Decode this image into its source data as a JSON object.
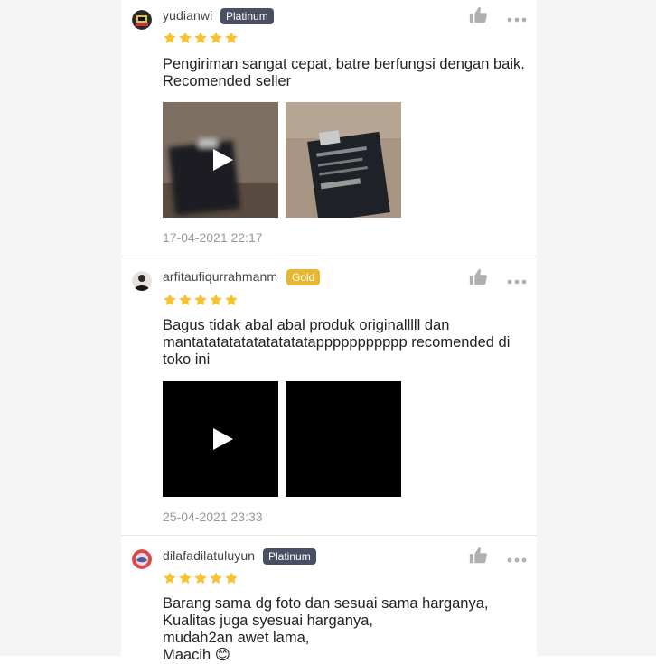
{
  "reviews": [
    {
      "username": "yudianwi",
      "badge": "Platinum",
      "rating": 5,
      "text_lines": [
        "Pengiriman sangat cepat, batre berfungsi dengan baik.",
        "Recomended seller"
      ],
      "timestamp": "17-04-2021 22:17",
      "media": [
        {
          "kind": "video",
          "icon": "play-icon"
        },
        {
          "kind": "photo"
        }
      ]
    },
    {
      "username": "arfitaufiqurrahmanm",
      "badge": "Gold",
      "rating": 5,
      "text_lines": [
        "Bagus tidak abal abal produk originalllll dan",
        "mantatatatatatatatatatappppppppppp recomended di",
        "toko ini"
      ],
      "timestamp": "25-04-2021 23:33",
      "media": [
        {
          "kind": "video",
          "icon": "play-icon"
        },
        {
          "kind": "photo"
        }
      ]
    },
    {
      "username": "dilafadilatuluyun",
      "badge": "Platinum",
      "rating": 5,
      "text_lines": [
        "Barang sama dg foto dan sesuai sama harganya,",
        "Kualitas juga syesuai harganya,",
        "mudah2an awet lama,",
        "Maacih 😊"
      ]
    }
  ],
  "colors": {
    "star": "#f6c231",
    "badge_platinum": "#4a4f63",
    "badge_gold": "#e9b631",
    "timestamp": "#999999",
    "icon": "#b0b0b0"
  }
}
